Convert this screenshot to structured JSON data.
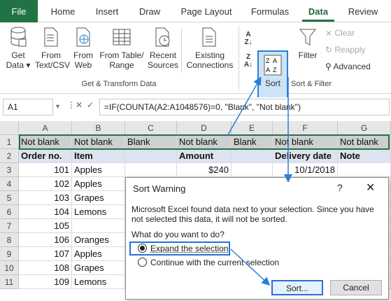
{
  "tabs": [
    "File",
    "Home",
    "Insert",
    "Draw",
    "Page Layout",
    "Formulas",
    "Data",
    "Review"
  ],
  "ribbon": {
    "get_data": [
      "Get",
      "Data ▾"
    ],
    "from_text": [
      "From",
      "Text/CSV"
    ],
    "from_web": [
      "From",
      "Web"
    ],
    "from_table": [
      "From Table/",
      "Range"
    ],
    "recent": [
      "Recent",
      "Sources"
    ],
    "existing": [
      "Existing",
      "Connections"
    ],
    "sort": "Sort",
    "filter": "Filter",
    "clear": "Clear",
    "reapply": "Reapply",
    "advanced": "Advanced",
    "group_get": "Get & Transform Data",
    "group_sort": "Sort & Filter"
  },
  "formula": {
    "name_box": "A1",
    "fx": "=IF(COUNTA(A2:A1048576)=0, \"Blank\", \"Not blank\")"
  },
  "grid": {
    "columns": [
      "A",
      "B",
      "C",
      "D",
      "E",
      "F",
      "G"
    ],
    "rows": [
      [
        "Not blank",
        "Not blank",
        "Blank",
        "Not blank",
        "Blank",
        "Not blank",
        "Not blank"
      ],
      [
        "Order no.",
        "Item",
        "",
        "Amount",
        "",
        "Delivery date",
        "Note"
      ],
      [
        "101",
        "Apples",
        "",
        "$240",
        "",
        "10/1/2018",
        ""
      ],
      [
        "102",
        "Apples",
        "",
        "",
        "",
        "",
        ""
      ],
      [
        "103",
        "Grapes",
        "",
        "",
        "",
        "",
        ""
      ],
      [
        "104",
        "Lemons",
        "",
        "",
        "",
        "",
        ""
      ],
      [
        "105",
        "",
        "",
        "",
        "",
        "",
        ""
      ],
      [
        "106",
        "Oranges",
        "",
        "",
        "",
        "",
        ""
      ],
      [
        "107",
        "Apples",
        "",
        "",
        "",
        "",
        ""
      ],
      [
        "108",
        "Grapes",
        "",
        "",
        "",
        "",
        ""
      ],
      [
        "109",
        "Lemons",
        "",
        "",
        "",
        "",
        ""
      ]
    ]
  },
  "dialog": {
    "title": "Sort Warning",
    "help": "?",
    "close": "✕",
    "message": "Microsoft Excel found data next to your selection.  Since you have not selected this data, it will not be sorted.",
    "question": "What do you want to do?",
    "option_expand": "Expand the selection",
    "option_continue": "Continue with the current selection",
    "selected": "expand",
    "sort_button": "Sort...",
    "cancel_button": "Cancel"
  },
  "colors": {
    "excel_green": "#217346",
    "highlight_blue": "#2a7fd6"
  }
}
